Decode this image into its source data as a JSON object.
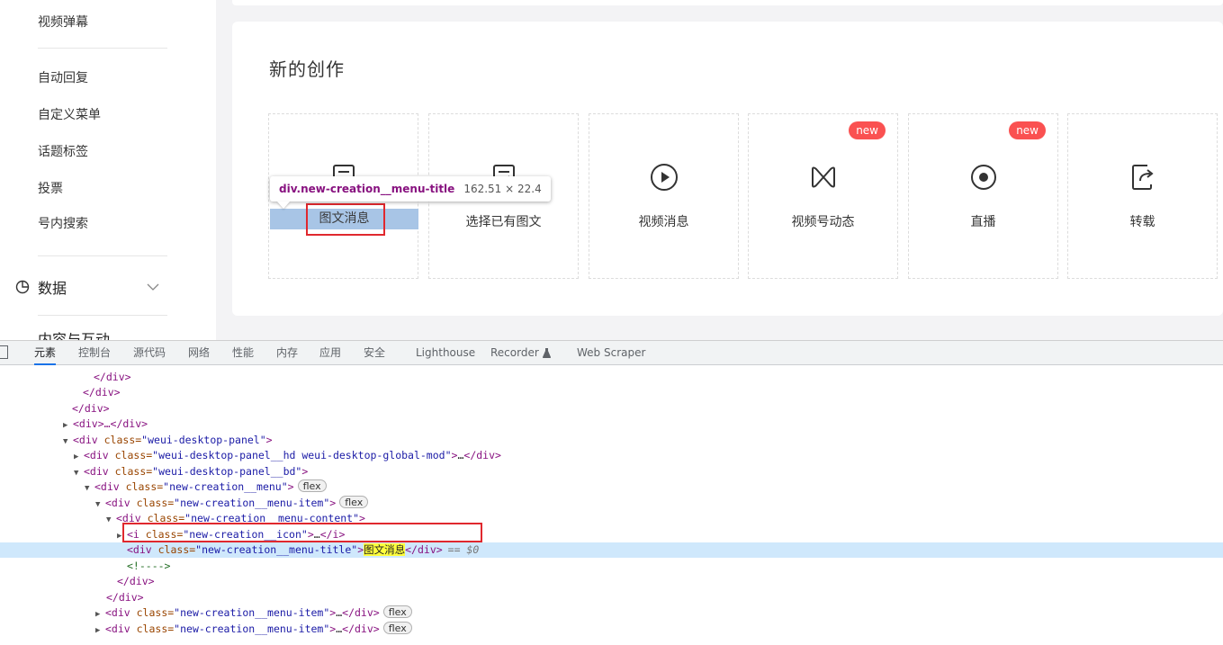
{
  "sidebar": {
    "items": [
      {
        "label": "视频弹幕"
      },
      {
        "label": "自动回复"
      },
      {
        "label": "自定义菜单"
      },
      {
        "label": "话题标签"
      },
      {
        "label": "投票"
      },
      {
        "label": "号内搜索"
      }
    ],
    "group": {
      "label": "数据",
      "icon": "pie-chart-icon",
      "state": "collapsed"
    },
    "cut_group_label": "内容与互动"
  },
  "panel": {
    "title": "新的创作",
    "cards": [
      {
        "title": "图文消息",
        "icon": "document-icon"
      },
      {
        "title": "选择已有图文",
        "icon": "document-select-icon"
      },
      {
        "title": "视频消息",
        "icon": "play-circle-icon"
      },
      {
        "title": "视频号动态",
        "icon": "channels-icon",
        "badge": "new"
      },
      {
        "title": "直播",
        "icon": "live-icon",
        "badge": "new"
      },
      {
        "title": "转载",
        "icon": "repost-icon"
      }
    ]
  },
  "inspector_tooltip": {
    "selector": "div.new-creation__menu-title",
    "size": "162.51 × 22.4"
  },
  "devtools": {
    "tabs": [
      {
        "label": "元素",
        "active": true
      },
      {
        "label": "控制台"
      },
      {
        "label": "源代码"
      },
      {
        "label": "网络"
      },
      {
        "label": "性能"
      },
      {
        "label": "内存"
      },
      {
        "label": "应用"
      },
      {
        "label": "安全"
      },
      {
        "label": "Lighthouse"
      },
      {
        "label": "Recorder"
      },
      {
        "label": "Web Scraper"
      }
    ],
    "dom": {
      "close_div": "</div>",
      "collapsed_div": "<div>…</div>",
      "tag_div_open": "<div",
      "tag_gt": ">",
      "tag_div_close": "</div>",
      "tag_i_open": "<i",
      "tag_i_close": "</i>",
      "attr_class": " class=",
      "ellipsis": "…",
      "comment": "<!---->",
      "flex": "flex",
      "dollar": "== $0",
      "classes": {
        "panel": "\"weui-desktop-panel\"",
        "panel_hd": "\"weui-desktop-panel__hd weui-desktop-global-mod\"",
        "panel_bd": "\"weui-desktop-panel__bd\"",
        "menu": "\"new-creation__menu\"",
        "menu_item": "\"new-creation__menu-item\"",
        "menu_content": "\"new-creation__menu-content\"",
        "icon": "\"new-creation__icon\"",
        "menu_title": "\"new-creation__menu-title\""
      },
      "selected_text": "图文消息"
    }
  }
}
